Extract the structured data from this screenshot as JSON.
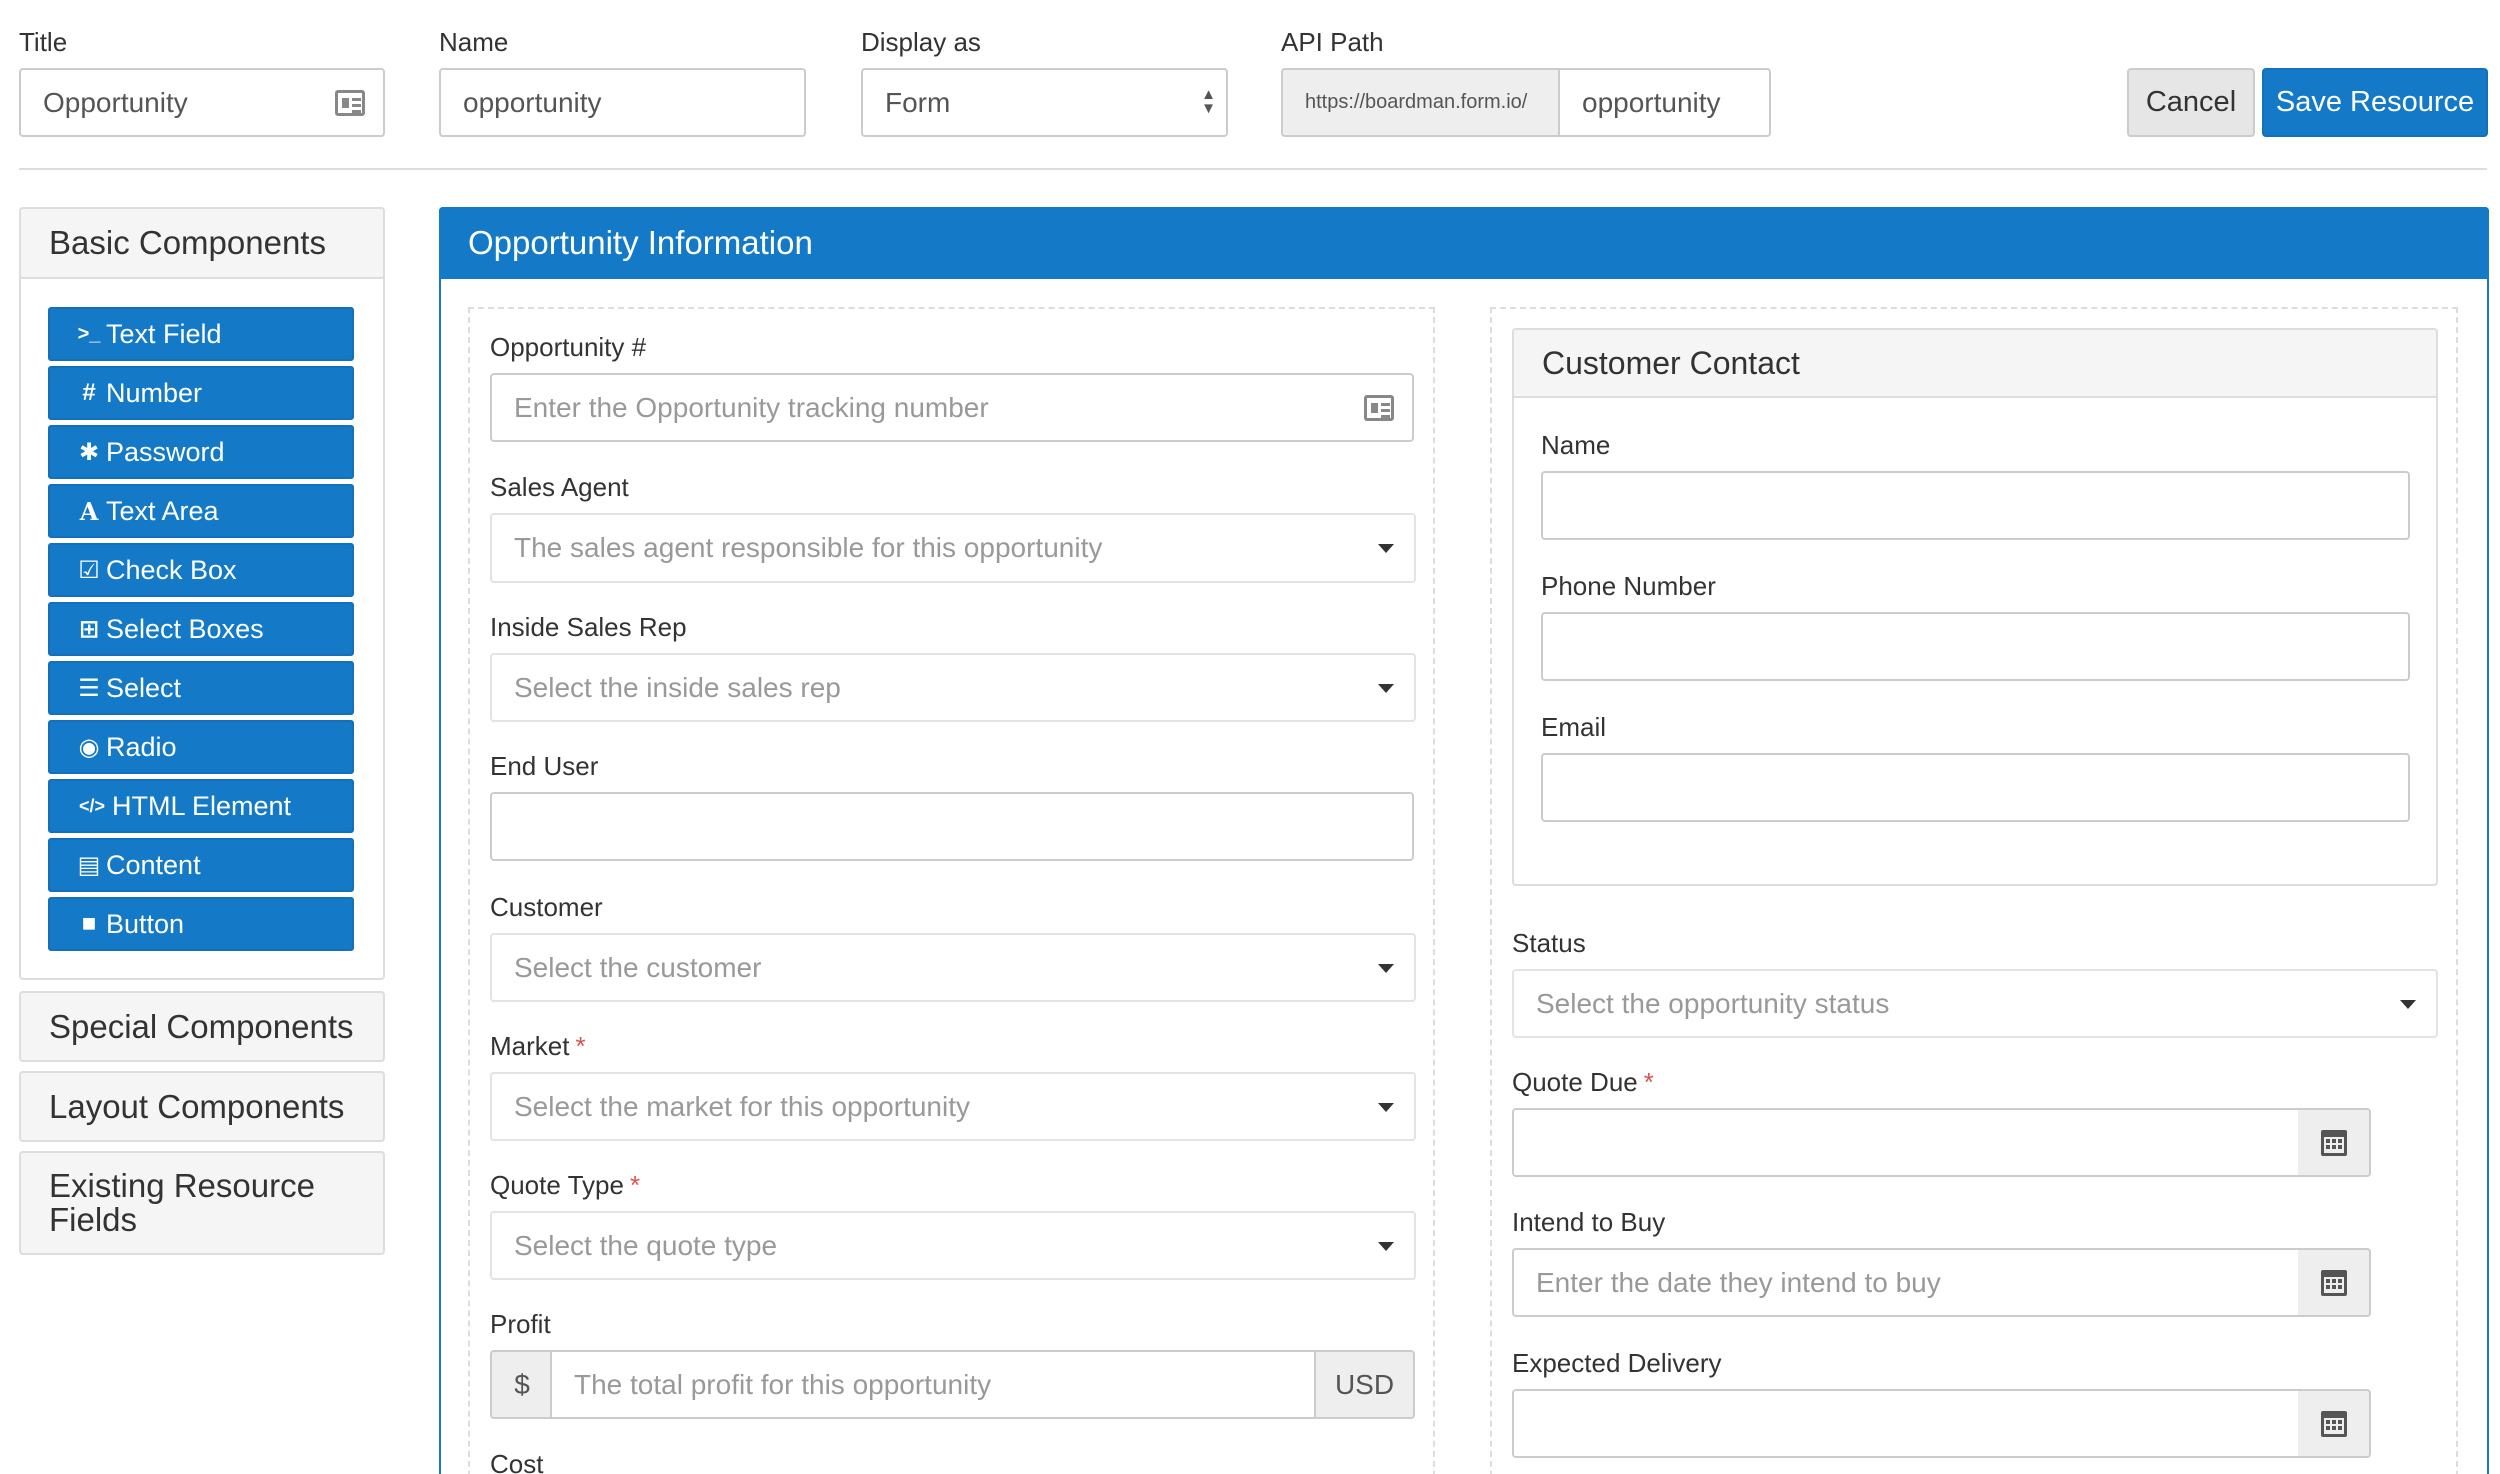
{
  "header": {
    "title_label": "Title",
    "title_value": "Opportunity",
    "name_label": "Name",
    "name_value": "opportunity",
    "display_label": "Display as",
    "display_value": "Form",
    "api_label": "API Path",
    "api_prefix": "https://boardman.form.io/",
    "api_value": "opportunity",
    "cancel_label": "Cancel",
    "save_label": "Save Resource"
  },
  "sidebar": {
    "basic_title": "Basic Components",
    "components": [
      {
        "label": "Text Field",
        "icon": "terminal-icon",
        "glyph": ">_"
      },
      {
        "label": "Number",
        "icon": "hash-icon",
        "glyph": "#"
      },
      {
        "label": "Password",
        "icon": "asterisk-icon",
        "glyph": "✱"
      },
      {
        "label": "Text Area",
        "icon": "font-icon",
        "glyph": "A"
      },
      {
        "label": "Check Box",
        "icon": "check-square-icon",
        "glyph": "☑"
      },
      {
        "label": "Select Boxes",
        "icon": "plus-square-icon",
        "glyph": "⊞"
      },
      {
        "label": "Select",
        "icon": "list-icon",
        "glyph": "☰"
      },
      {
        "label": "Radio",
        "icon": "dot-circle-icon",
        "glyph": "◉"
      },
      {
        "label": "HTML Element",
        "icon": "code-icon",
        "glyph": "</>"
      },
      {
        "label": "Content",
        "icon": "html5-icon",
        "glyph": "▤"
      },
      {
        "label": "Button",
        "icon": "stop-icon",
        "glyph": "■"
      }
    ],
    "special_title": "Special Components",
    "layout_title": "Layout Components",
    "existing_title_line1": "Existing Resource",
    "existing_title_line2": "Fields"
  },
  "panel": {
    "title": "Opportunity Information",
    "left": {
      "opportunity_label": "Opportunity #",
      "opportunity_placeholder": "Enter the Opportunity tracking number",
      "sales_agent_label": "Sales Agent",
      "sales_agent_placeholder": "The sales agent responsible for this opportunity",
      "inside_rep_label": "Inside Sales Rep",
      "inside_rep_placeholder": "Select the inside sales rep",
      "end_user_label": "End User",
      "customer_label": "Customer",
      "customer_placeholder": "Select the customer",
      "market_label": "Market",
      "market_placeholder": "Select the market for this opportunity",
      "quote_type_label": "Quote Type",
      "quote_type_placeholder": "Select the quote type",
      "profit_label": "Profit",
      "profit_prefix": "$",
      "profit_placeholder": "The total profit for this opportunity",
      "profit_suffix": "USD",
      "cost_label": "Cost",
      "required_mark": "*"
    },
    "right": {
      "contact_title": "Customer Contact",
      "name_label": "Name",
      "phone_label": "Phone Number",
      "email_label": "Email",
      "status_label": "Status",
      "status_placeholder": "Select the opportunity status",
      "quote_due_label": "Quote Due",
      "intend_label": "Intend to Buy",
      "intend_placeholder": "Enter the date they intend to buy",
      "delivery_label": "Expected Delivery",
      "required_mark": "*"
    }
  },
  "colors": {
    "primary": "#1479c6",
    "required": "#d9534f",
    "panel_border": "#1479c6"
  }
}
